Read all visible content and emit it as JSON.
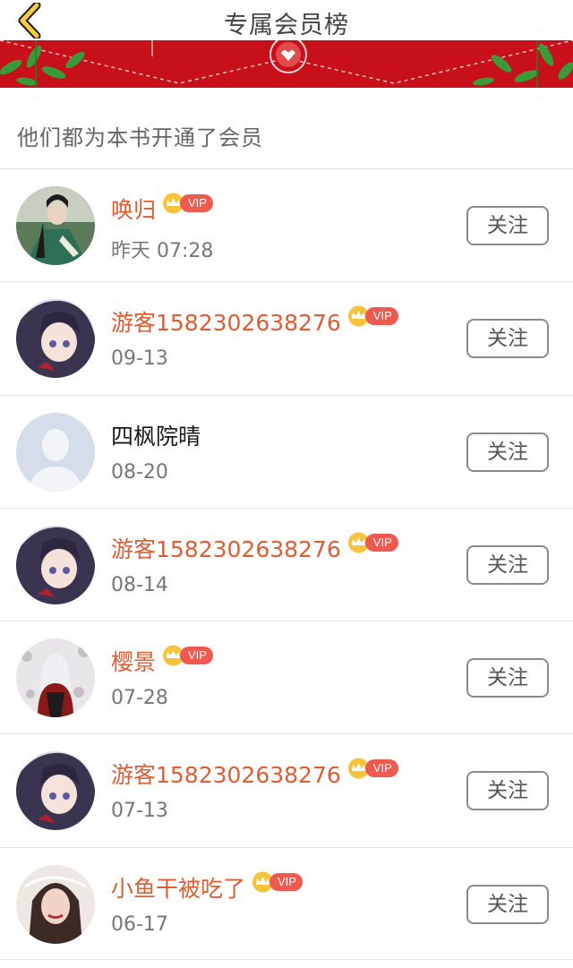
{
  "header": {
    "title": "专属会员榜"
  },
  "intro": "他们都为本书开通了会员",
  "vip_label": "VIP",
  "members": [
    {
      "name": "唤归",
      "vip": true,
      "date": "昨天 07:28",
      "follow": "关注",
      "avatar": "avatar-green-robe"
    },
    {
      "name": "游客1582302638276",
      "vip": true,
      "date": "09-13",
      "follow": "关注",
      "avatar": "avatar-anime-boy"
    },
    {
      "name": "四枫院晴",
      "vip": false,
      "date": "08-20",
      "follow": "关注",
      "avatar": "avatar-default"
    },
    {
      "name": "游客1582302638276",
      "vip": true,
      "date": "08-14",
      "follow": "关注",
      "avatar": "avatar-anime-boy"
    },
    {
      "name": "樱景",
      "vip": true,
      "date": "07-28",
      "follow": "关注",
      "avatar": "avatar-white-hair"
    },
    {
      "name": "游客1582302638276",
      "vip": true,
      "date": "07-13",
      "follow": "关注",
      "avatar": "avatar-anime-boy"
    },
    {
      "name": "小鱼干被吃了",
      "vip": true,
      "date": "06-17",
      "follow": "关注",
      "avatar": "avatar-woman"
    }
  ],
  "colors": {
    "accent": "#e25c32",
    "banner": "#c8101a",
    "vip_tag": "#ef5a50"
  }
}
